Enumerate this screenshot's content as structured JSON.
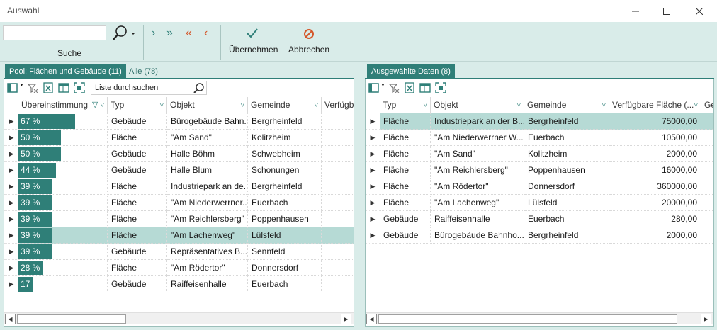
{
  "window": {
    "title": "Auswahl"
  },
  "toolbar": {
    "search_label": "Suche",
    "search_value": "",
    "accept_label": "Übernehmen",
    "cancel_label": "Abbrechen",
    "accent_color": "#2f7f78",
    "cancel_color": "#d4572a"
  },
  "left": {
    "tabs": [
      "Pool: Flächen und Gebäude (11)",
      "Alle (78)"
    ],
    "list_search_placeholder": "Liste durchsuchen",
    "headers": [
      "Übereinstimmung",
      "Typ",
      "Objekt",
      "Gemeinde",
      "Verfügb"
    ],
    "rows": [
      {
        "match": "67 %",
        "pct": 67,
        "typ": "Gebäude",
        "objekt": "Bürogebäude  Bahn...",
        "gemeinde": "Bergrheinfeld"
      },
      {
        "match": "50 %",
        "pct": 50,
        "typ": "Fläche",
        "objekt": "\"Am Sand\"",
        "gemeinde": "Kolitzheim"
      },
      {
        "match": "50 %",
        "pct": 50,
        "typ": "Gebäude",
        "objekt": "Halle Böhm",
        "gemeinde": "Schwebheim"
      },
      {
        "match": "44 %",
        "pct": 44,
        "typ": "Gebäude",
        "objekt": "Halle Blum",
        "gemeinde": "Schonungen"
      },
      {
        "match": "39 %",
        "pct": 39,
        "typ": "Fläche",
        "objekt": "Industriepark an de...",
        "gemeinde": "Bergrheinfeld"
      },
      {
        "match": "39 %",
        "pct": 39,
        "typ": "Fläche",
        "objekt": "\"Am Niederwerrner...",
        "gemeinde": "Euerbach"
      },
      {
        "match": "39 %",
        "pct": 39,
        "typ": "Fläche",
        "objekt": "\"Am Reichlersberg\"",
        "gemeinde": "Poppenhausen"
      },
      {
        "match": "39 %",
        "pct": 39,
        "typ": "Fläche",
        "objekt": "\"Am Lachenweg\"",
        "gemeinde": "Lülsfeld"
      },
      {
        "match": "39 %",
        "pct": 39,
        "typ": "Gebäude",
        "objekt": "Repräsentatives  B...",
        "gemeinde": "Sennfeld"
      },
      {
        "match": "28 %",
        "pct": 28,
        "typ": "Fläche",
        "objekt": "\"Am Rödertor\"",
        "gemeinde": "Donnersdorf"
      },
      {
        "match": "17 %",
        "pct": 17,
        "typ": "Gebäude",
        "objekt": "Raiffeisenhalle",
        "gemeinde": "Euerbach"
      }
    ],
    "selected_row": 7
  },
  "right": {
    "tabs": [
      "Ausgewählte Daten (8)"
    ],
    "headers": [
      "Typ",
      "Objekt",
      "Gemeinde",
      "Verfügbare Fläche (...",
      "Ge"
    ],
    "rows": [
      {
        "typ": "Fläche",
        "objekt": "Industriepark an der B...",
        "gemeinde": "Bergrheinfeld",
        "flaeche": "75000,00"
      },
      {
        "typ": "Fläche",
        "objekt": "\"Am Niederwerrner W...",
        "gemeinde": "Euerbach",
        "flaeche": "10500,00"
      },
      {
        "typ": "Fläche",
        "objekt": "\"Am Sand\"",
        "gemeinde": "Kolitzheim",
        "flaeche": "2000,00"
      },
      {
        "typ": "Fläche",
        "objekt": "\"Am Reichlersberg\"",
        "gemeinde": "Poppenhausen",
        "flaeche": "16000,00"
      },
      {
        "typ": "Fläche",
        "objekt": "\"Am Rödertor\"",
        "gemeinde": "Donnersdorf",
        "flaeche": "360000,00"
      },
      {
        "typ": "Fläche",
        "objekt": "\"Am Lachenweg\"",
        "gemeinde": "Lülsfeld",
        "flaeche": "20000,00"
      },
      {
        "typ": "Gebäude",
        "objekt": "Raiffeisenhalle",
        "gemeinde": "Euerbach",
        "flaeche": "280,00"
      },
      {
        "typ": "Gebäude",
        "objekt": "Bürogebäude  Bahnho...",
        "gemeinde": "Bergrheinfeld",
        "flaeche": "2000,00"
      }
    ],
    "selected_row": 0
  }
}
